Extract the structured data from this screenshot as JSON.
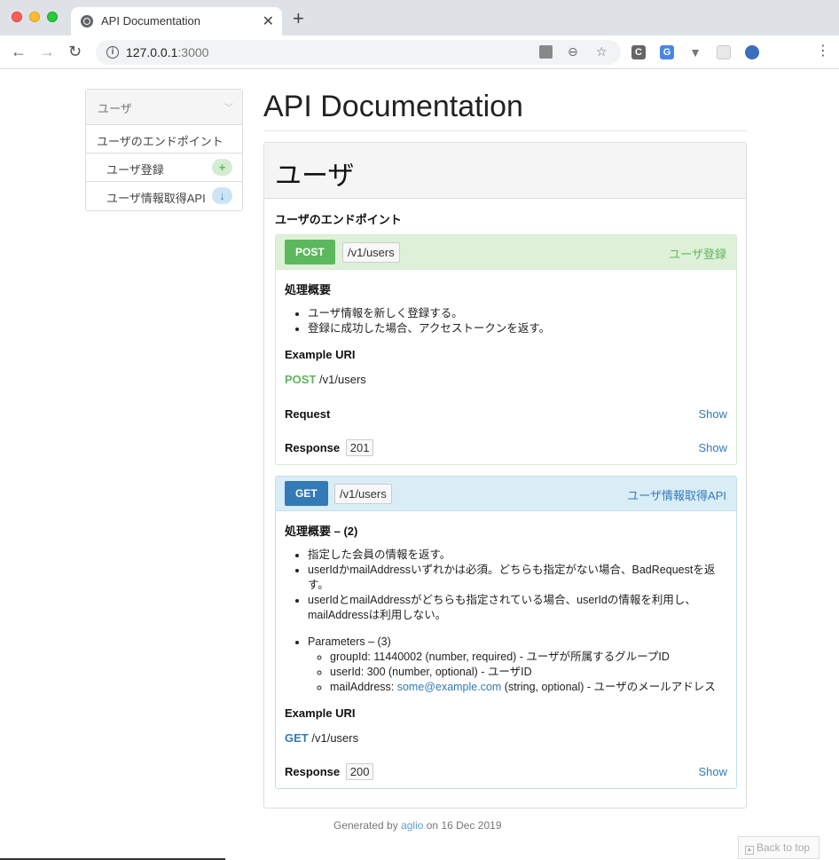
{
  "browser": {
    "tab_title": "API Documentation",
    "url_host": "127.0.0.1",
    "url_port": ":3000"
  },
  "sidebar": {
    "header": "ユーザ",
    "group": "ユーザのエンドポイント",
    "items": [
      {
        "label": "ユーザ登録",
        "badge": "+"
      },
      {
        "label": "ユーザ情報取得API",
        "badge": "↓"
      }
    ]
  },
  "main": {
    "title": "API Documentation",
    "resource_title": "ユーザ",
    "section_title": "ユーザのエンドポイント",
    "actions": [
      {
        "method": "POST",
        "uri": "/v1/users",
        "name": "ユーザ登録",
        "desc_heading": "処理概要",
        "bullets": [
          "ユーザ情報を新しく登録する。",
          "登録に成功した場合、アクセストークンを返す。"
        ],
        "example_label": "Example URI",
        "example_method": "POST",
        "example_path": "/v1/users",
        "request_label": "Request",
        "response_label": "Response",
        "response_code": "201",
        "show_label": "Show"
      },
      {
        "method": "GET",
        "uri": "/v1/users",
        "name": "ユーザ情報取得API",
        "desc_heading": "処理概要 – (2)",
        "bullets": [
          "指定した会員の情報を返す。",
          "userIdかmailAddressいずれかは必須。どちらも指定がない場合、BadRequestを返す。",
          "userIdとmailAddressがどちらも指定されている場合、userIdの情報を利用し、mailAddressは利用しない。"
        ],
        "params_heading": "Parameters – (3)",
        "params": [
          "groupId: 11440002 (number, required) - ユーザが所属するグループID",
          "userId: 300 (number, optional) - ユーザID"
        ],
        "param3_prefix": "mailAddress: ",
        "param3_link": "some@example.com",
        "param3_suffix": " (string, optional) - ユーザのメールアドレス",
        "example_label": "Example URI",
        "example_method": "GET",
        "example_path": "/v1/users",
        "response_label": "Response",
        "response_code": "200",
        "show_label": "Show"
      }
    ]
  },
  "footer": {
    "prefix": "Generated by ",
    "link": "aglio",
    "suffix": " on 16 Dec 2019"
  },
  "back_to_top": "Back to top"
}
